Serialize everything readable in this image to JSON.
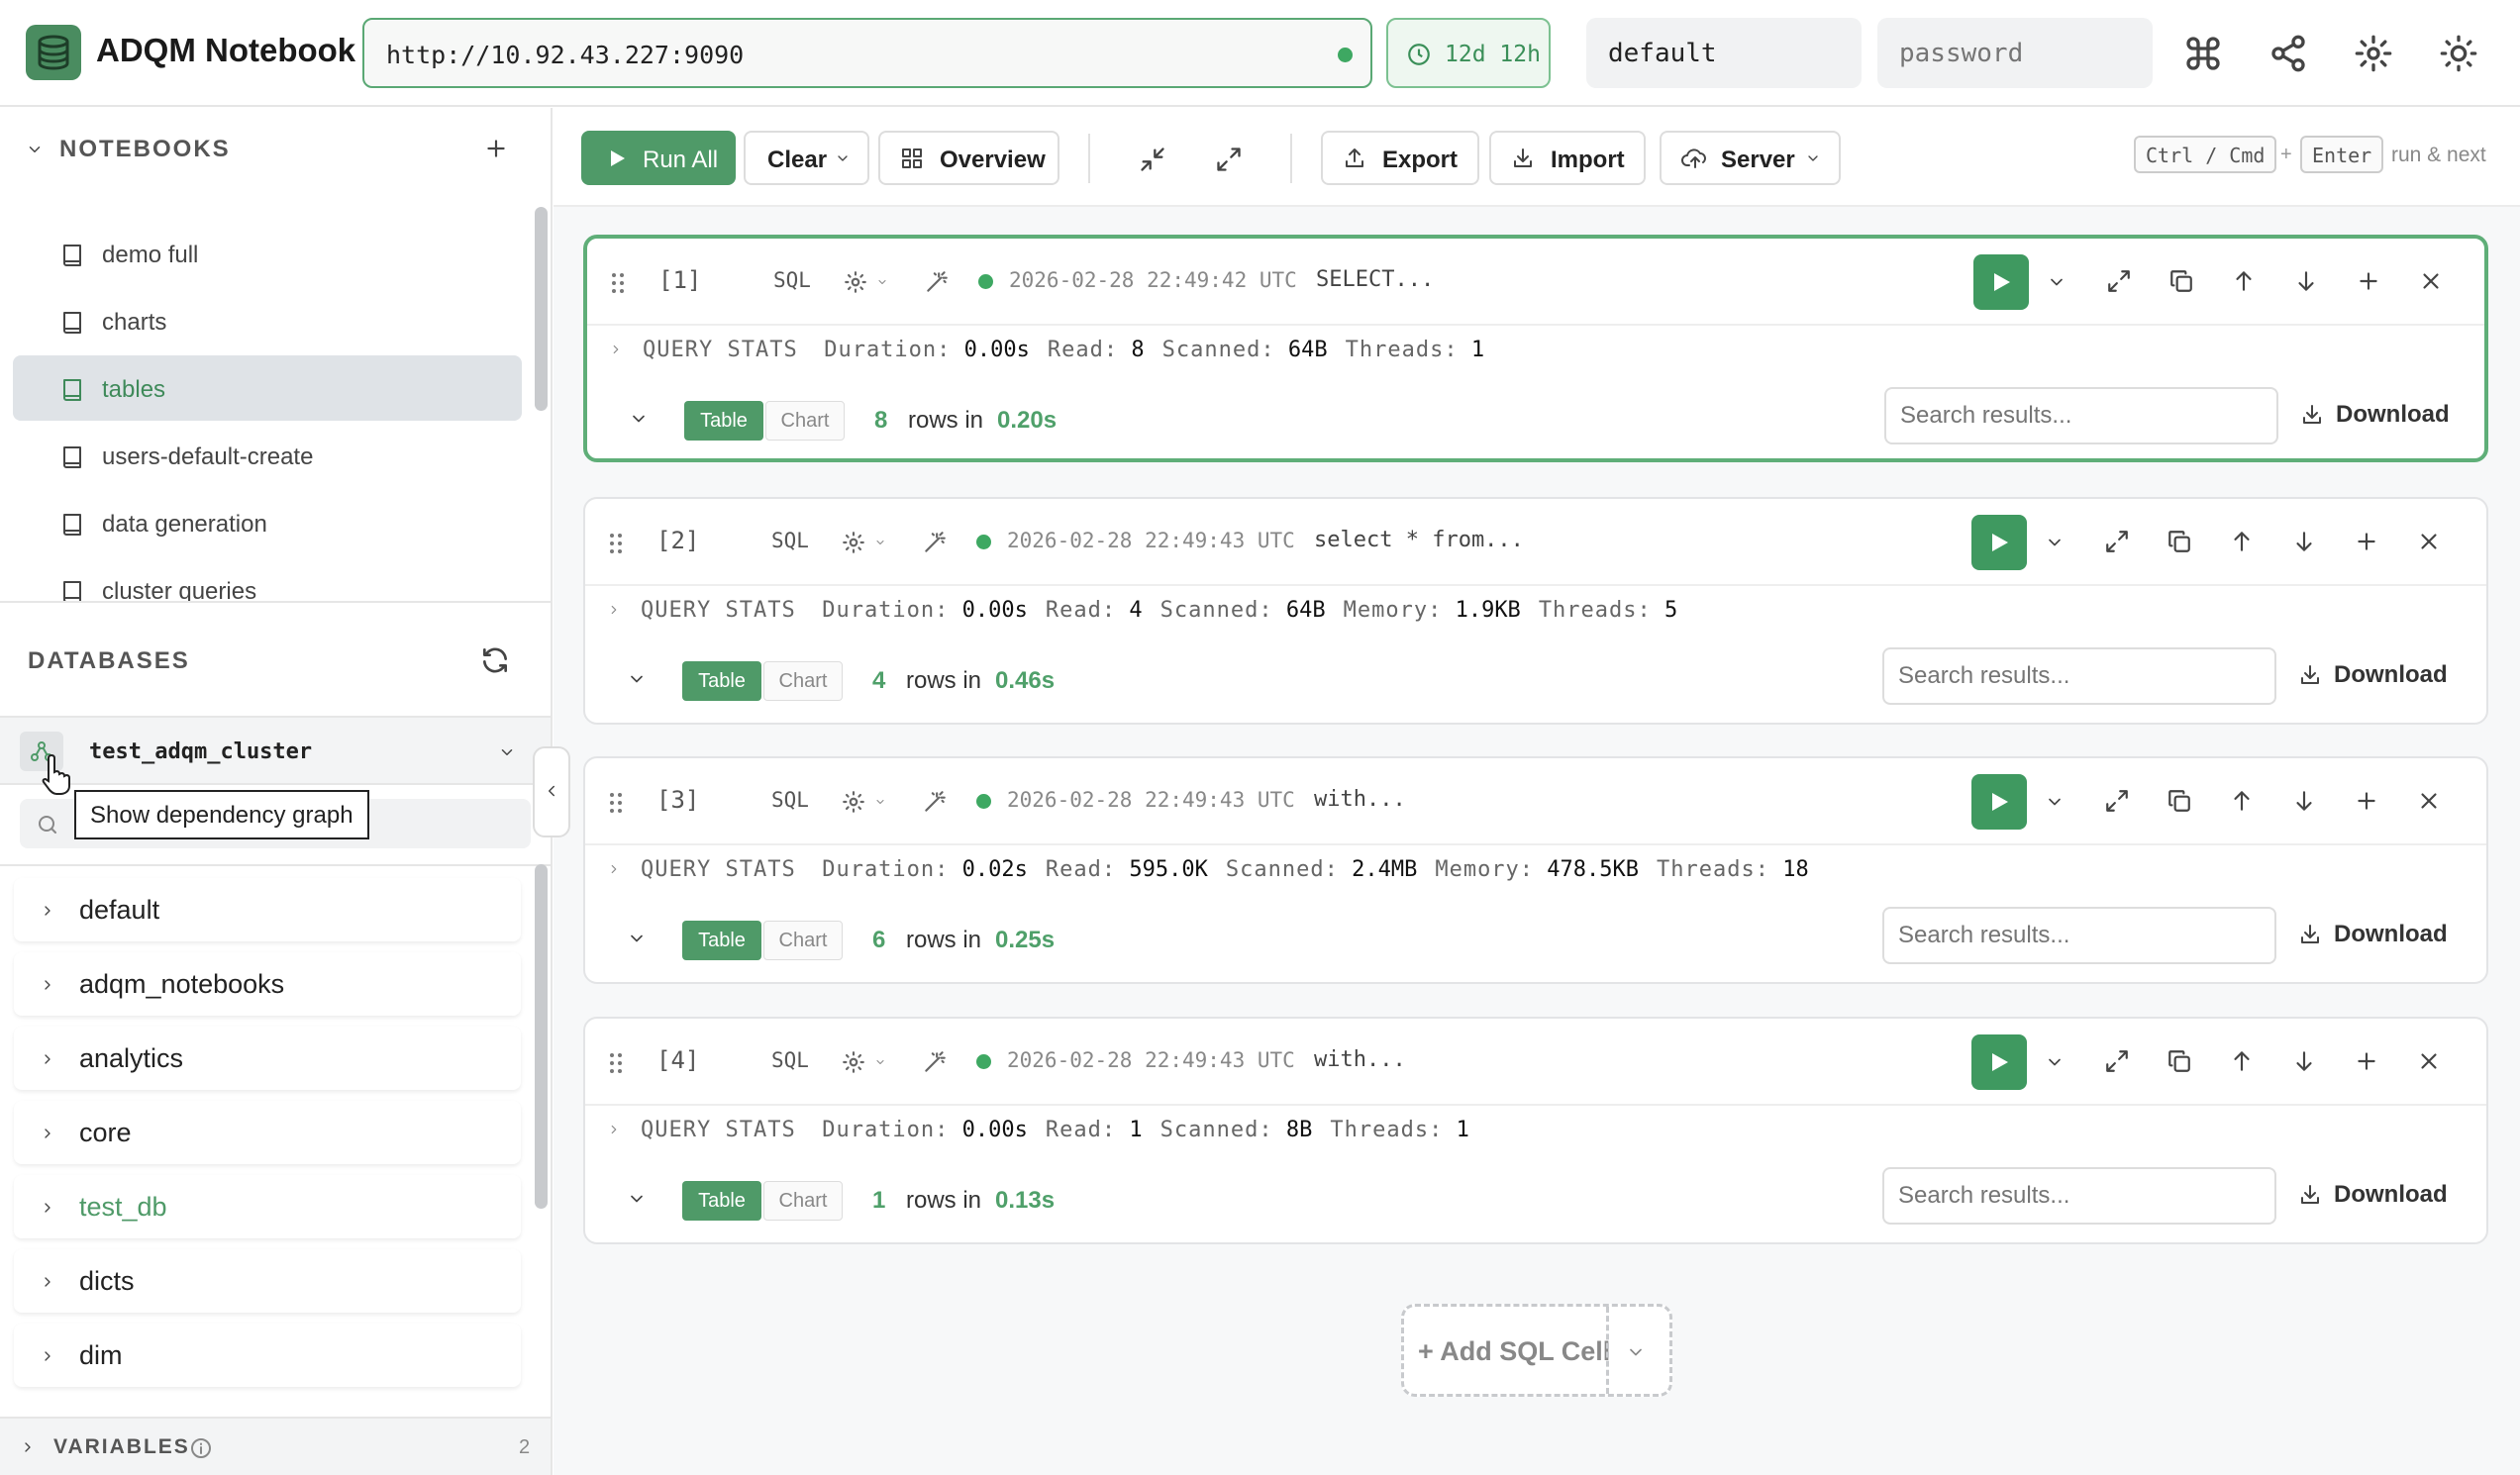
{
  "app": {
    "title": "ADQM Notebook"
  },
  "topbar": {
    "url": "http://10.92.43.227:9090",
    "uptime": "12d 12h",
    "user_value": "default",
    "password_placeholder": "password",
    "icons": [
      "command-icon",
      "share-icon",
      "gear-icon",
      "sun-icon"
    ]
  },
  "sidebar": {
    "notebooks_title": "NOTEBOOKS",
    "notebooks": [
      {
        "label": "demo full"
      },
      {
        "label": "charts"
      },
      {
        "label": "tables",
        "active": true
      },
      {
        "label": "users-default-create"
      },
      {
        "label": "data generation"
      },
      {
        "label": "cluster queries"
      }
    ],
    "databases_title": "DATABASES",
    "cluster": "test_adqm_cluster",
    "tooltip": "Show dependency graph",
    "databases": [
      {
        "label": "default"
      },
      {
        "label": "adqm_notebooks"
      },
      {
        "label": "analytics"
      },
      {
        "label": "core"
      },
      {
        "label": "test_db",
        "highlight": true
      },
      {
        "label": "dicts"
      },
      {
        "label": "dim"
      }
    ],
    "variables_title": "VARIABLES",
    "variables_count": "2"
  },
  "toolbar": {
    "run_all": "Run All",
    "clear": "Clear",
    "overview": "Overview",
    "export": "Export",
    "import": "Import",
    "server": "Server",
    "kbd1": "Ctrl / Cmd",
    "plus": "+",
    "kbd2": "Enter",
    "hint": "run & next"
  },
  "cells": [
    {
      "num": "[1]",
      "lang": "SQL",
      "time": "2026-02-28 22:49:42 UTC",
      "sql": "SELECT...",
      "stats_label": "QUERY STATS",
      "stats": [
        {
          "k": "Duration:",
          "v": "0.00s"
        },
        {
          "k": "Read:",
          "v": "8"
        },
        {
          "k": "Scanned:",
          "v": "64B"
        },
        {
          "k": "Threads:",
          "v": "1"
        }
      ],
      "table": "Table",
      "chart": "Chart",
      "rows": "8",
      "rows_label": "rows in",
      "elapsed": "0.20s",
      "search_placeholder": "Search results...",
      "download": "Download"
    },
    {
      "num": "[2]",
      "lang": "SQL",
      "time": "2026-02-28 22:49:43 UTC",
      "sql": "select * from...",
      "stats_label": "QUERY STATS",
      "stats": [
        {
          "k": "Duration:",
          "v": "0.00s"
        },
        {
          "k": "Read:",
          "v": "4"
        },
        {
          "k": "Scanned:",
          "v": "64B"
        },
        {
          "k": "Memory:",
          "v": "1.9KB"
        },
        {
          "k": "Threads:",
          "v": "5"
        }
      ],
      "table": "Table",
      "chart": "Chart",
      "rows": "4",
      "rows_label": "rows in",
      "elapsed": "0.46s",
      "search_placeholder": "Search results...",
      "download": "Download"
    },
    {
      "num": "[3]",
      "lang": "SQL",
      "time": "2026-02-28 22:49:43 UTC",
      "sql": "with...",
      "stats_label": "QUERY STATS",
      "stats": [
        {
          "k": "Duration:",
          "v": "0.02s"
        },
        {
          "k": "Read:",
          "v": "595.0K"
        },
        {
          "k": "Scanned:",
          "v": "2.4MB"
        },
        {
          "k": "Memory:",
          "v": "478.5KB"
        },
        {
          "k": "Threads:",
          "v": "18"
        }
      ],
      "table": "Table",
      "chart": "Chart",
      "rows": "6",
      "rows_label": "rows in",
      "elapsed": "0.25s",
      "search_placeholder": "Search results...",
      "download": "Download"
    },
    {
      "num": "[4]",
      "lang": "SQL",
      "time": "2026-02-28 22:49:43 UTC",
      "sql": "with...",
      "stats_label": "QUERY STATS",
      "stats": [
        {
          "k": "Duration:",
          "v": "0.00s"
        },
        {
          "k": "Read:",
          "v": "1"
        },
        {
          "k": "Scanned:",
          "v": "8B"
        },
        {
          "k": "Threads:",
          "v": "1"
        }
      ],
      "table": "Table",
      "chart": "Chart",
      "rows": "1",
      "rows_label": "rows in",
      "elapsed": "0.13s",
      "search_placeholder": "Search results...",
      "download": "Download"
    }
  ],
  "add_cell": "+ Add SQL Cell",
  "colors": {
    "accent": "#4f9a68",
    "active_border": "#5fae78"
  }
}
